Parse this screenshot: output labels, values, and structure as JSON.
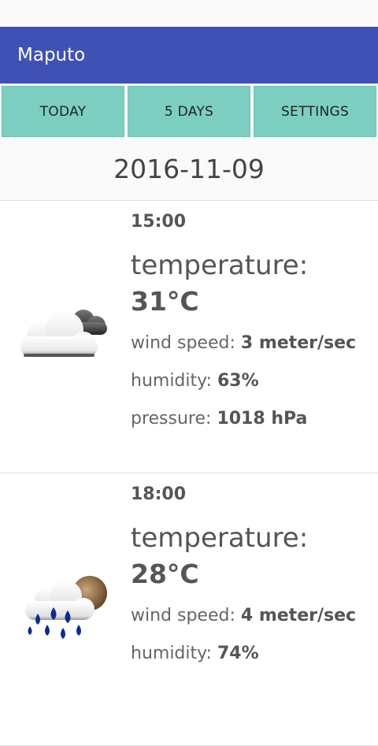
{
  "app": {
    "title": "Maputo"
  },
  "tabs": [
    {
      "label": "TODAY"
    },
    {
      "label": "5 DAYS"
    },
    {
      "label": "SETTINGS"
    }
  ],
  "date": "2016-11-09",
  "forecast": [
    {
      "time": "15:00",
      "temperature_label": "temperature:",
      "temperature": "31°C",
      "wind_label": "wind speed: ",
      "wind": "3 meter/sec",
      "humidity_label": "humidity: ",
      "humidity": "63%",
      "pressure_label": "pressure: ",
      "pressure": "1018 hPa",
      "icon": "cloudy-icon"
    },
    {
      "time": "18:00",
      "temperature_label": "temperature:",
      "temperature": "28°C",
      "wind_label": "wind speed: ",
      "wind": "4 meter/sec",
      "humidity_label": "humidity: ",
      "humidity": "74%",
      "icon": "rain-icon"
    }
  ],
  "colors": {
    "app_bar": "#3f51b5",
    "tab": "#7ccfc0"
  }
}
